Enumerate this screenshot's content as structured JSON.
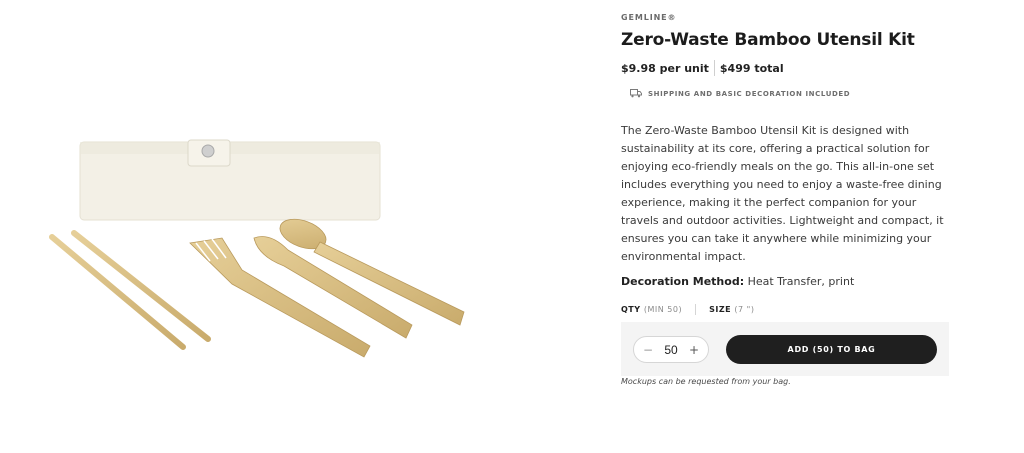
{
  "product": {
    "brand": "GEMLINE®",
    "title": "Zero-Waste Bamboo Utensil Kit",
    "price_per_unit": "$9.98 per unit",
    "price_total": "$499 total",
    "shipping_note": "SHIPPING AND BASIC DECORATION INCLUDED",
    "shipping_icon": "truck-icon",
    "description": "The Zero-Waste Bamboo Utensil Kit is designed with sustainability at its core, offering a practical solution for enjoying eco-friendly meals on the go. This all-in-one set includes everything you need to enjoy a waste-free dining experience, making it the perfect companion for your travels and outdoor activities. Lightweight and compact, it ensures you can take it anywhere while minimizing your environmental impact.",
    "decoration_label": "Decoration Method:",
    "decoration_value": "Heat Transfer, print"
  },
  "options": {
    "qty_label": "QTY",
    "qty_min": "(MIN 50)",
    "size_label": "SIZE",
    "size_value": "(7 \")"
  },
  "cart": {
    "minus": "−",
    "quantity": "50",
    "plus": "+",
    "add_button": "ADD (50) TO BAG",
    "mockups_note": "Mockups can be requested from your bag."
  },
  "colors": {
    "button_bg": "#1f1f1f",
    "bamboo": "#d8bf86",
    "pouch": "#f2efe4"
  }
}
